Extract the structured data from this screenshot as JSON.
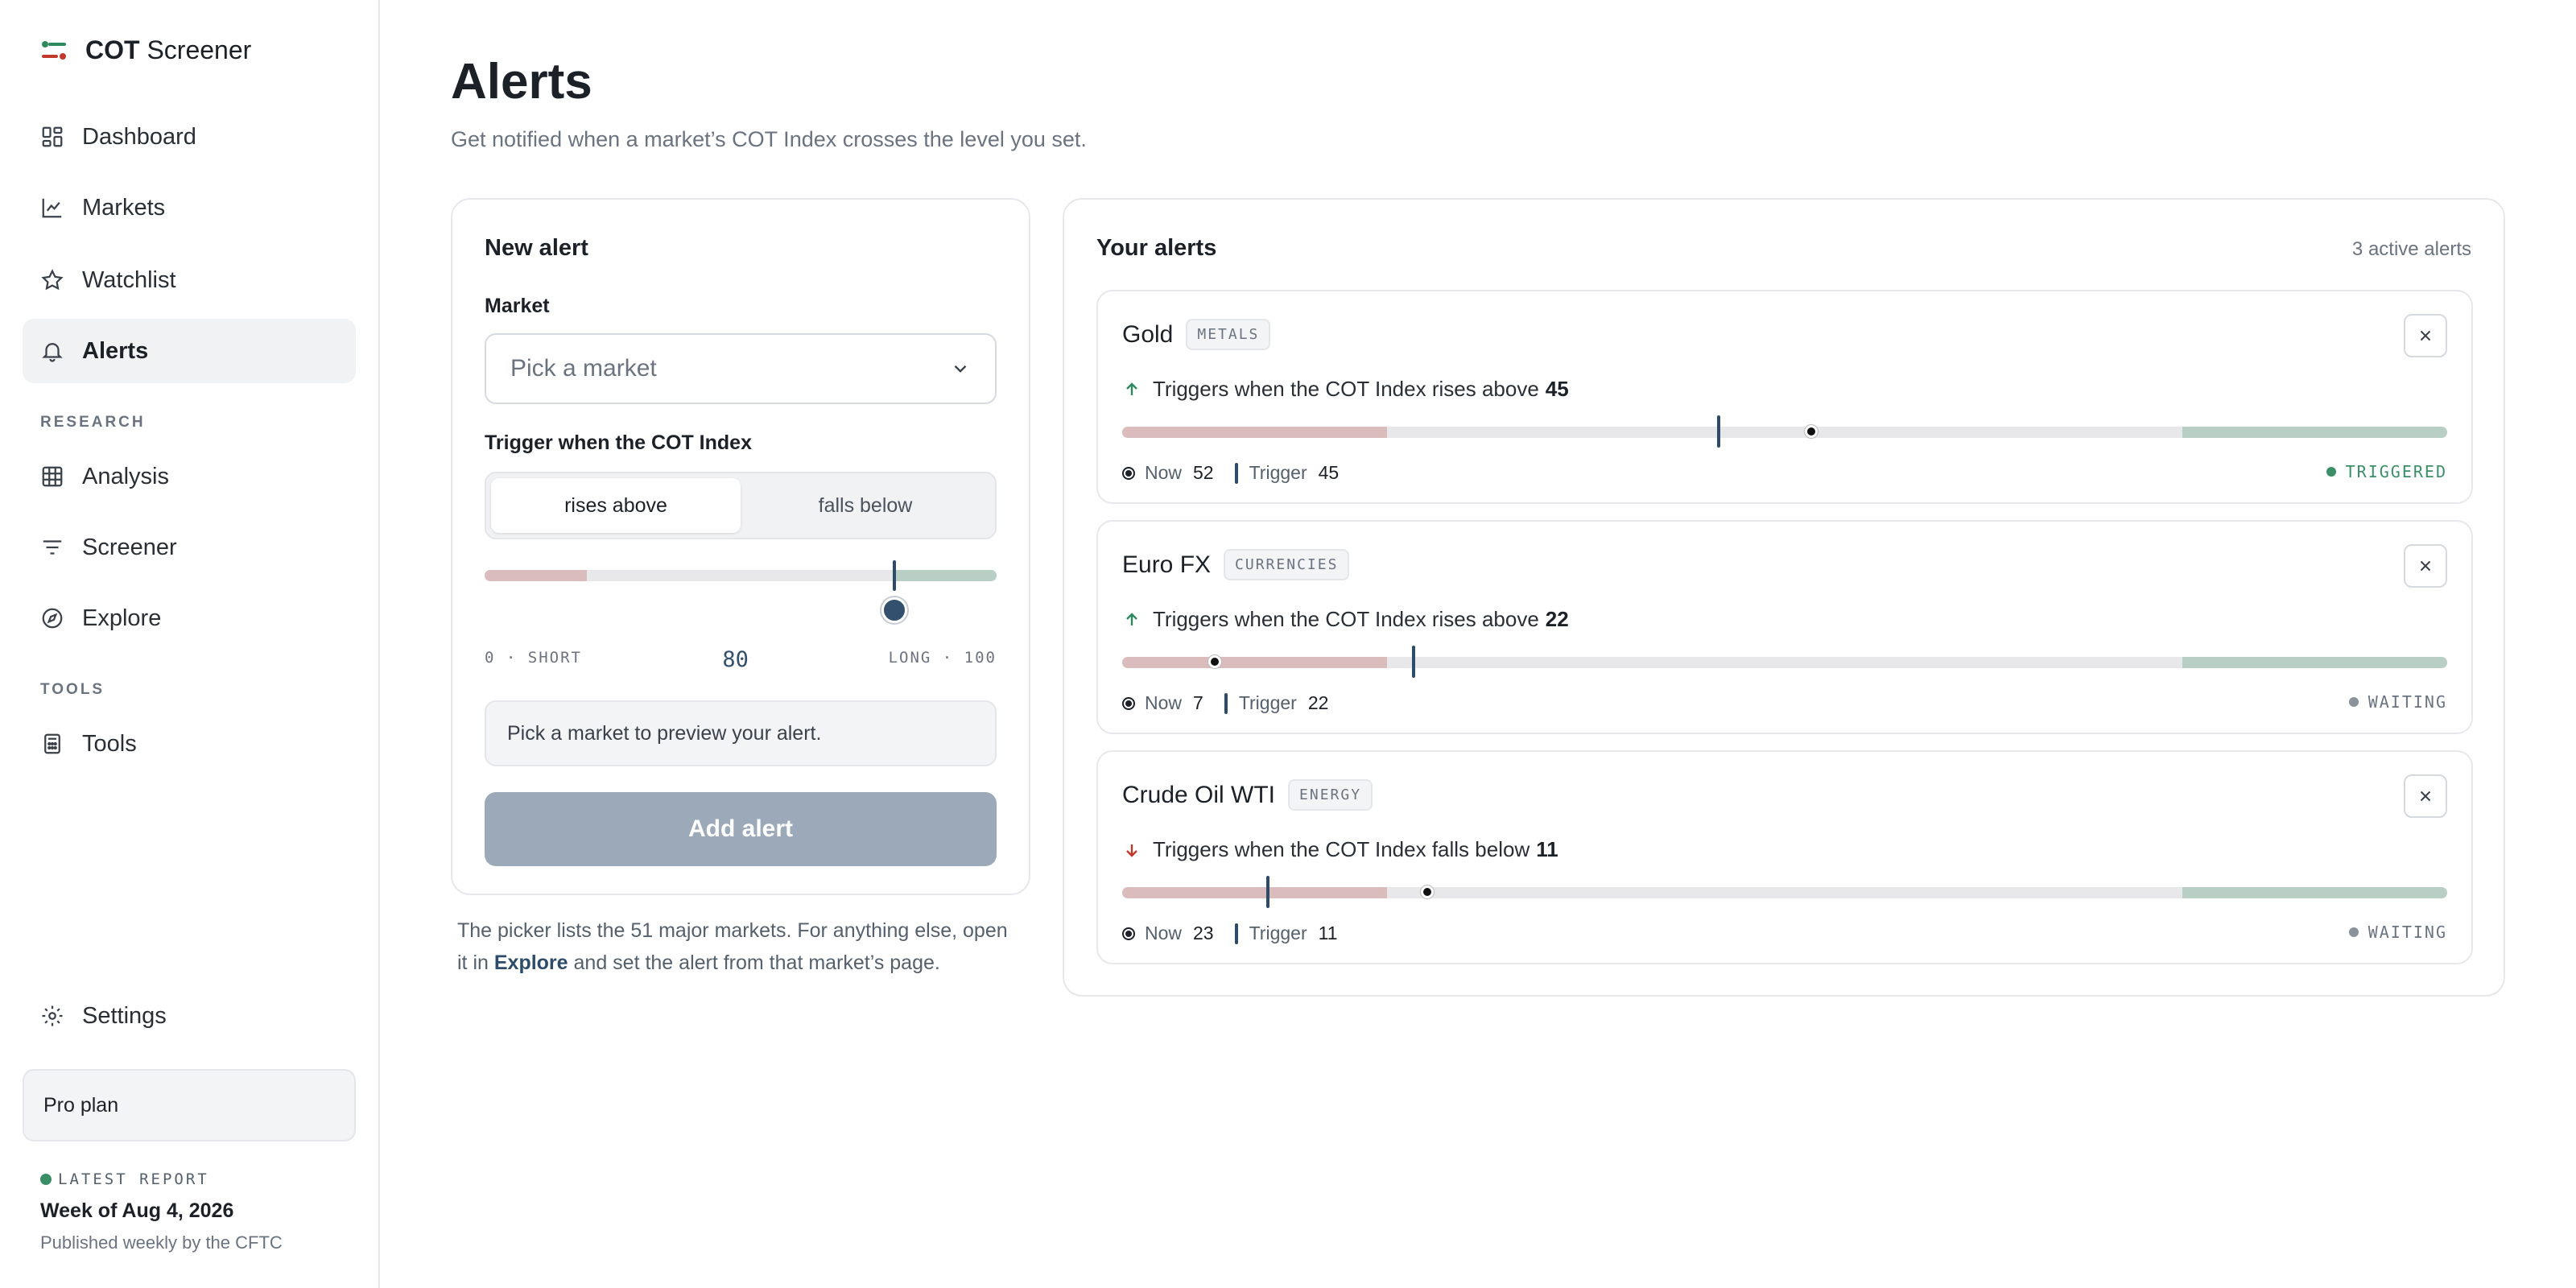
{
  "app": {
    "brand_bold": "COT",
    "brand_rest": " Screener"
  },
  "sidebar": {
    "items": [
      {
        "label": "Dashboard",
        "icon": "dashboard-icon"
      },
      {
        "label": "Markets",
        "icon": "chart-line-icon"
      },
      {
        "label": "Watchlist",
        "icon": "star-icon"
      },
      {
        "label": "Alerts",
        "icon": "bell-icon",
        "active": true
      }
    ],
    "research_label": "RESEARCH",
    "research_items": [
      {
        "label": "Analysis",
        "icon": "grid-icon"
      },
      {
        "label": "Screener",
        "icon": "filter-icon"
      },
      {
        "label": "Explore",
        "icon": "compass-icon"
      }
    ],
    "tools_label": "TOOLS",
    "tools_items": [
      {
        "label": "Tools",
        "icon": "calculator-icon"
      }
    ],
    "settings_label": "Settings",
    "plan_label": "Pro plan",
    "latest_report": {
      "label": "LATEST REPORT",
      "week": "Week of Aug 4, 2026",
      "published": "Published weekly by the CFTC"
    }
  },
  "page": {
    "title": "Alerts",
    "subtitle": "Get notified when a market’s COT Index crosses the level you set."
  },
  "new_alert": {
    "title": "New alert",
    "market_label": "Market",
    "market_placeholder": "Pick a market",
    "trigger_label": "Trigger when the COT Index",
    "direction_options": [
      "rises above",
      "falls below"
    ],
    "direction_selected": "rises above",
    "threshold": 80,
    "scale_min_label": "0 · SHORT",
    "scale_max_label": "LONG · 100",
    "short_zone_max": 20,
    "long_zone_min": 80,
    "preview_text": "Pick a market to preview your alert.",
    "add_button": "Add alert",
    "note_before": "The picker lists the 51 major markets. For anything else, open it in ",
    "note_link": "Explore",
    "note_after": " and set the alert from that market’s page."
  },
  "your_alerts": {
    "title": "Your alerts",
    "active_count": "3 active alerts",
    "now_label": "Now",
    "trigger_label": "Trigger",
    "alerts": [
      {
        "name": "Gold",
        "tag": "METALS",
        "direction": "up",
        "condition": "Triggers when the COT Index rises above",
        "trigger": 45,
        "now": 52,
        "status": "TRIGGERED"
      },
      {
        "name": "Euro FX",
        "tag": "CURRENCIES",
        "direction": "up",
        "condition": "Triggers when the COT Index rises above",
        "trigger": 22,
        "now": 7,
        "status": "WAITING"
      },
      {
        "name": "Crude Oil WTI",
        "tag": "ENERGY",
        "direction": "down",
        "condition": "Triggers when the COT Index falls below",
        "trigger": 11,
        "now": 23,
        "status": "WAITING"
      }
    ]
  },
  "colors": {
    "accent": "#2d4b6b",
    "short_zone": "#dbbcbd",
    "long_zone": "#b9cfc6",
    "triggered": "#3a8f66",
    "up_arrow": "#2e8a5e",
    "down_arrow": "#c0392b"
  }
}
